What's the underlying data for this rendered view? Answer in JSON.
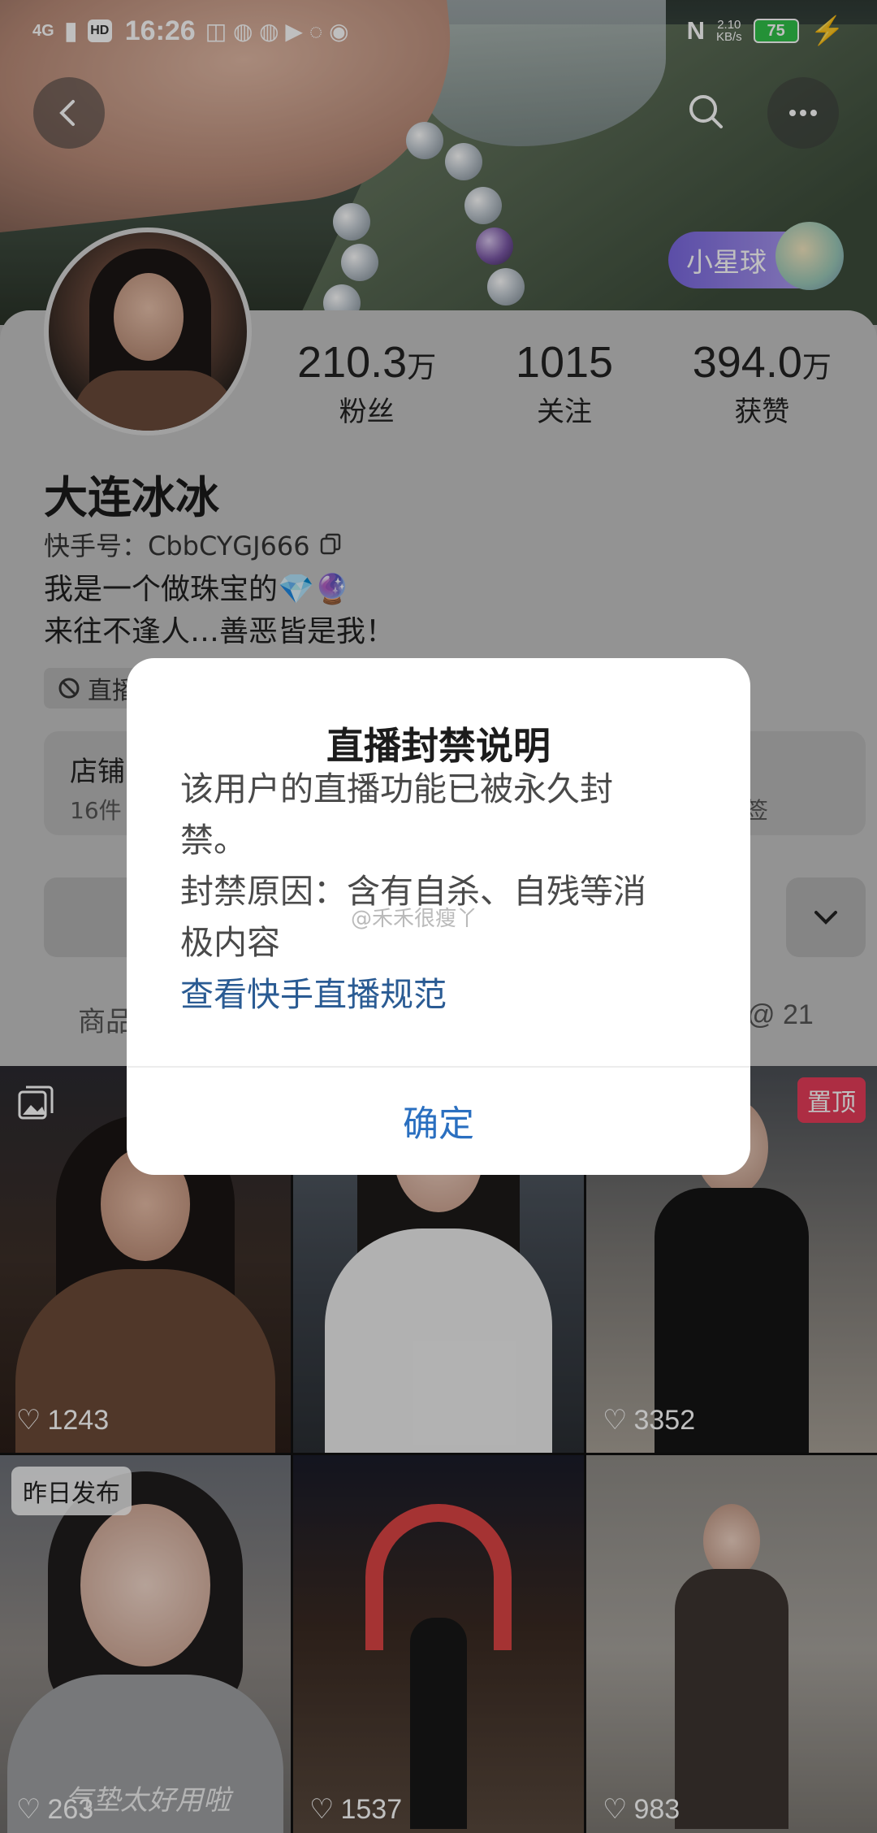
{
  "status_bar": {
    "network": "4G",
    "hd": "HD",
    "time": "16:26",
    "speed": "2.10",
    "speed_unit": "KB/s",
    "battery": "75"
  },
  "header": {
    "planet_label": "小星球"
  },
  "profile": {
    "name": "大连冰冰",
    "kuaishou_id": "快手号：CbbCYGJ666",
    "bio_line1": "我是一个做珠宝的💎🔮",
    "bio_line2": "来往不逢人…善恶皆是我！",
    "ban_tag": "直播",
    "stats": [
      {
        "value": "210.3",
        "unit": "万",
        "label": "粉丝"
      },
      {
        "value": "1015",
        "unit": "",
        "label": "关注"
      },
      {
        "value": "394.0",
        "unit": "万",
        "label": "获赞"
      }
    ],
    "shop_title": "店铺",
    "shop_sub": "16件",
    "shop_right": "签"
  },
  "tabs": {
    "left": "商品",
    "right": "@ 21"
  },
  "grid": [
    {
      "likes": "1243"
    },
    {
      "likes": ""
    },
    {
      "likes": "3352",
      "badge": "置顶"
    },
    {
      "likes": "263",
      "badge": "昨日发布",
      "caption": "气垫太好用啦"
    },
    {
      "likes": "1537"
    },
    {
      "likes": "983"
    }
  ],
  "dialog": {
    "title": "直播封禁说明",
    "line1": "该用户的直播功能已被永久封",
    "line2": "禁。",
    "line3": "封禁原因：含有自杀、自残等消",
    "line4": "极内容",
    "link": "查看快手直播规范",
    "confirm": "确定"
  },
  "watermark": "@禾禾很瘦丫"
}
